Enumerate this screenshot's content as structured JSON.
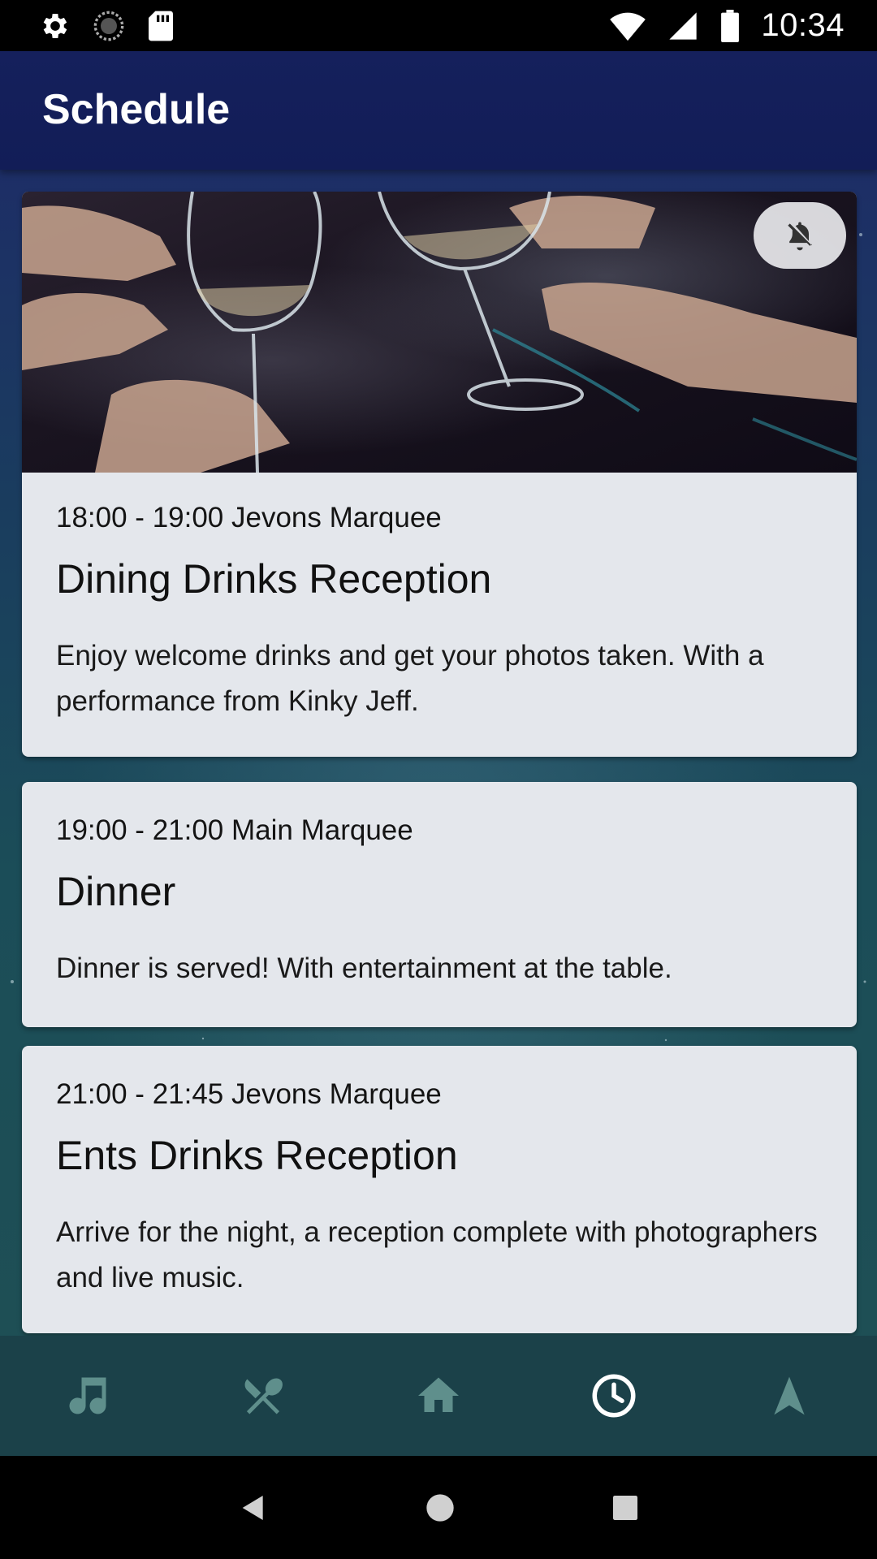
{
  "status_bar": {
    "time": "10:34",
    "icons_left": [
      "settings-icon",
      "sync-icon",
      "sd-card-icon"
    ],
    "icons_right": [
      "wifi-icon",
      "signal-icon",
      "battery-icon"
    ]
  },
  "app_bar": {
    "title": "Schedule"
  },
  "events": [
    {
      "meta": "18:00 - 19:00 Jevons Marquee",
      "title": "Dining Drinks Reception",
      "description": "Enjoy welcome drinks and get your photos taken. With a performance from Kinky Jeff.",
      "has_image": true,
      "image_icon": "notifications-off-icon"
    },
    {
      "meta": "19:00 - 21:00 Main Marquee",
      "title": "Dinner",
      "description": "Dinner is served! With entertainment at the table."
    },
    {
      "meta": "21:00 - 21:45 Jevons Marquee",
      "title": "Ents Drinks Reception",
      "description": "Arrive for the night, a reception complete with photographers and live music."
    }
  ],
  "bottom_nav": {
    "items": [
      {
        "icon": "music-note-icon",
        "active": false
      },
      {
        "icon": "cutlery-icon",
        "active": false
      },
      {
        "icon": "home-icon",
        "active": false
      },
      {
        "icon": "clock-icon",
        "active": true
      },
      {
        "icon": "navigation-arrow-icon",
        "active": false
      }
    ],
    "inactive_color": "#5f8f8c",
    "active_color": "#ffffff"
  },
  "system_nav": [
    "back-icon",
    "home-circle-icon",
    "recents-icon"
  ]
}
